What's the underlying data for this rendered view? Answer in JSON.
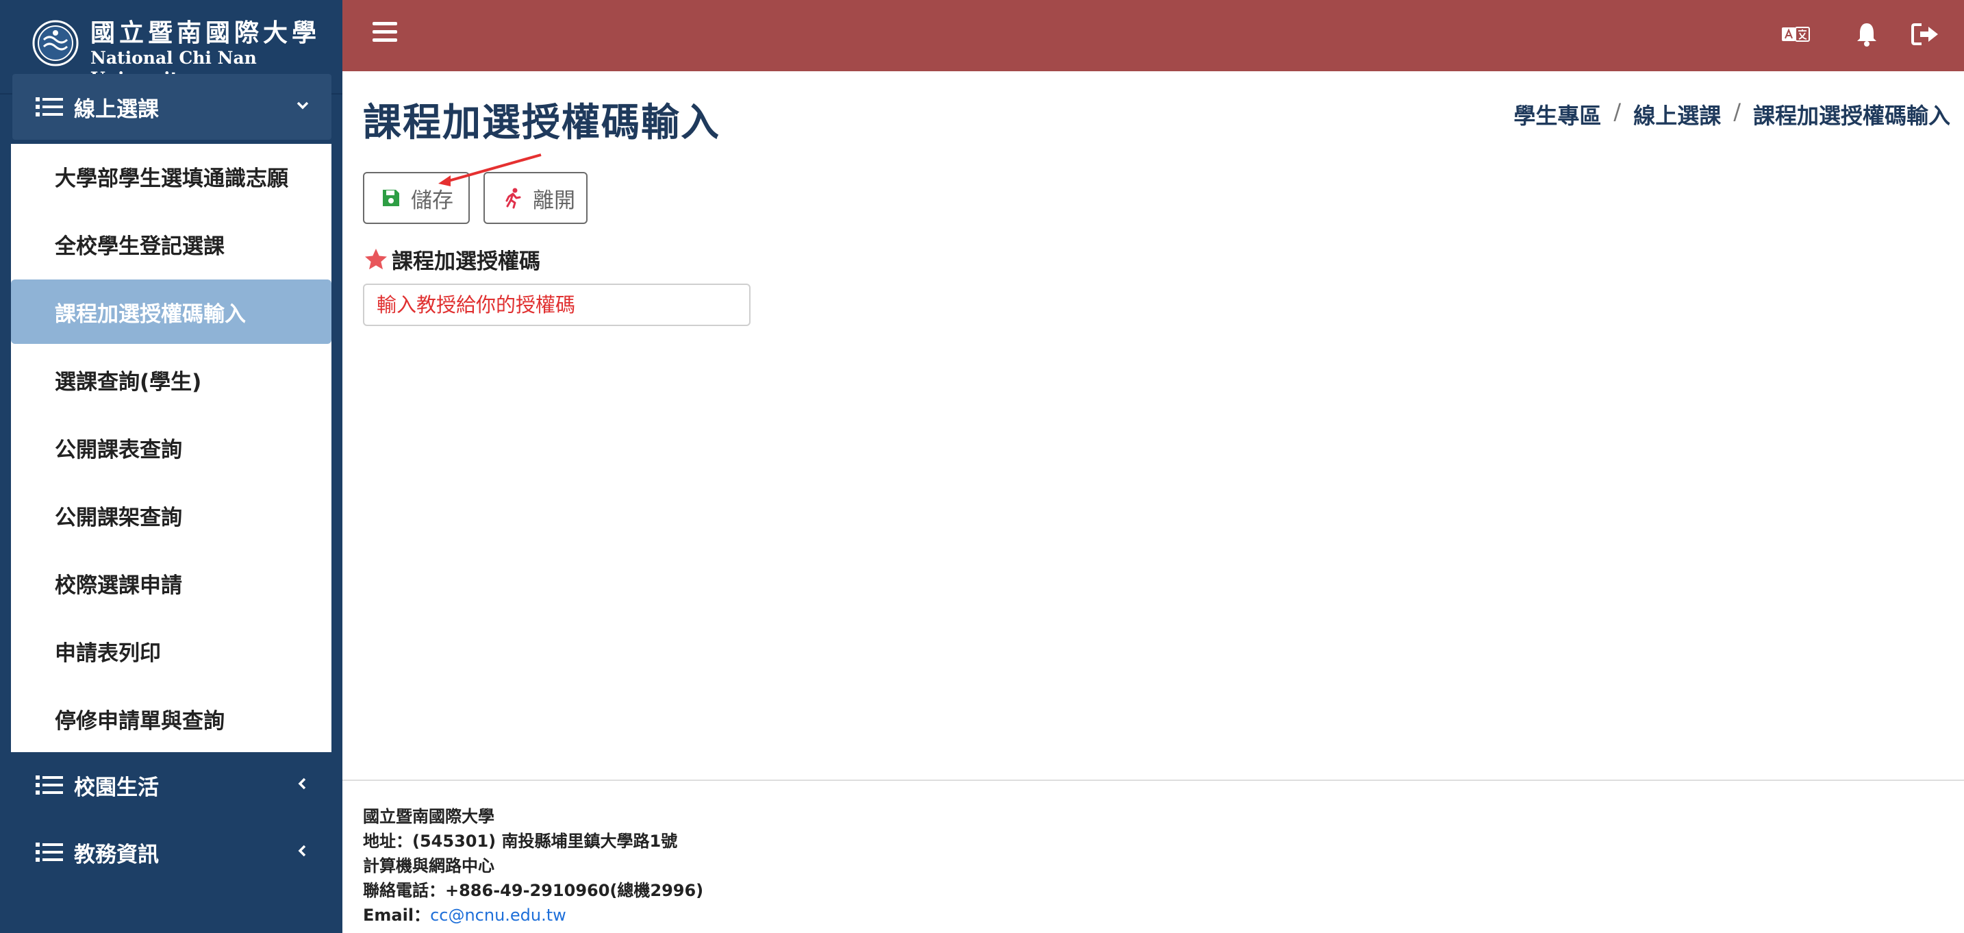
{
  "brand": {
    "name_zh": "國立暨南國際大學",
    "name_en": "National Chi Nan University"
  },
  "sidebar": {
    "groups": [
      {
        "label": "線上選課",
        "state": "expanded"
      },
      {
        "label": "校園生活",
        "state": "collapsed"
      },
      {
        "label": "教務資訊",
        "state": "collapsed"
      }
    ],
    "submenu": [
      {
        "label": "大學部學生選填通識志願"
      },
      {
        "label": "全校學生登記選課"
      },
      {
        "label": "課程加選授權碼輸入",
        "active": true
      },
      {
        "label": "選課查詢(學生)"
      },
      {
        "label": "公開課表查詢"
      },
      {
        "label": "公開課架查詢"
      },
      {
        "label": "校際選課申請"
      },
      {
        "label": "申請表列印"
      },
      {
        "label": "停修申請單與查詢"
      }
    ]
  },
  "topbar": {
    "icons": [
      "menu-icon",
      "translate-icon",
      "bell-icon",
      "logout-icon"
    ],
    "color": "#a34a4a"
  },
  "main": {
    "title": "課程加選授權碼輸入",
    "breadcrumb": [
      "學生專區",
      "線上選課",
      "課程加選授權碼輸入"
    ],
    "breadcrumb_sep": "/",
    "buttons": {
      "save_label": "儲存",
      "leave_label": "離開"
    },
    "form": {
      "field_label": "課程加選授權碼",
      "input_placeholder": "輸入教授給你的授權碼",
      "input_value": ""
    }
  },
  "footer": {
    "name": "國立暨南國際大學",
    "address": "地址：(545301) 南投縣埔里鎮大學路1號",
    "unit": "計算機與網路中心",
    "phone": "聯絡電話：+886-49-2910960(總機2996)",
    "email_label": "Email：",
    "email": "cc@ncnu.edu.tw"
  },
  "colors": {
    "sidebar_bg": "#1d3f66",
    "topbar_bg": "#a34a4a",
    "active_item": "#8fb3d6",
    "title_text": "#1f3a5c",
    "save_icon": "#2e9e44",
    "leave_icon": "#e0304a",
    "placeholder": "#e03030"
  }
}
